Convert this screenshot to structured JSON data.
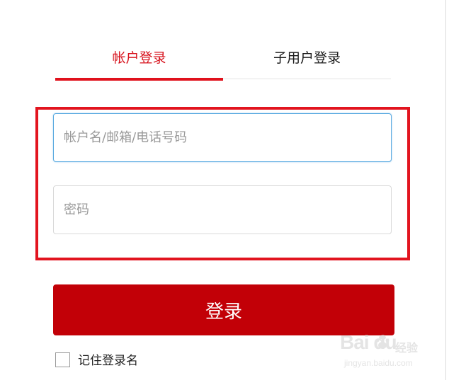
{
  "tabs": {
    "account_login": "帐户登录",
    "subuser_login": "子用户登录",
    "active": "account_login"
  },
  "form": {
    "username_placeholder": "帐户名/邮箱/电话号码",
    "username_value": "",
    "password_placeholder": "密码",
    "password_value": "",
    "login_label": "登录",
    "remember_label": "记住登录名",
    "remember_checked": false
  },
  "watermark": {
    "logo_text": "Bai du",
    "product_text": "经验",
    "domain_text": "jingyan.baidu.com"
  },
  "colors": {
    "brand_red": "#e0111c",
    "button_red": "#c20007",
    "focus_blue": "#58a9e0",
    "annotation_red": "#e2141f"
  }
}
